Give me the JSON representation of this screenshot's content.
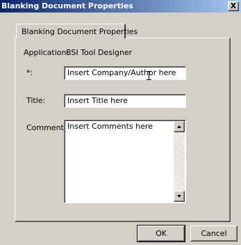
{
  "window": {
    "title": "Blanking Document Properties",
    "close_label": "X"
  },
  "tab": {
    "label": "Blanking Document Properties"
  },
  "form": {
    "application_label": "Application:",
    "application_value": "BSI Tool Designer",
    "author_label": "*:",
    "author_value": "Insert Company/Author here",
    "title_label": "Title:",
    "title_value": "Insert Title here",
    "comments_label": "Comments:",
    "comments_value": "Insert Comments here"
  },
  "buttons": {
    "ok": "OK",
    "cancel": "Cancel"
  },
  "colors": {
    "titlebar_start": "#0a246a",
    "titlebar_end": "#a6caf0",
    "face": "#d4d0c8"
  }
}
